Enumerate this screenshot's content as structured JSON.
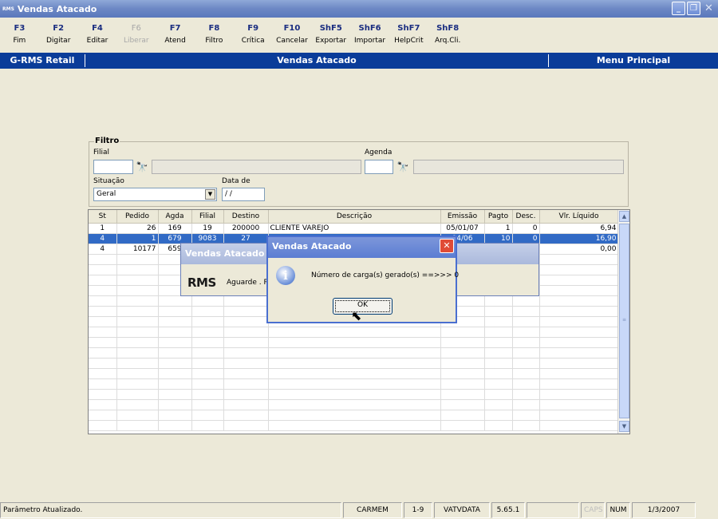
{
  "window": {
    "title": "Vendas Atacado",
    "app_icon_text": "RMS"
  },
  "toolbar": [
    {
      "key": "F3",
      "label": "Fim",
      "enabled": true
    },
    {
      "key": "F2",
      "label": "Digitar",
      "enabled": true
    },
    {
      "key": "F4",
      "label": "Editar",
      "enabled": true
    },
    {
      "key": "F6",
      "label": "Liberar",
      "enabled": false
    },
    {
      "key": "F7",
      "label": "Atend",
      "enabled": true
    },
    {
      "key": "F8",
      "label": "Filtro",
      "enabled": true
    },
    {
      "key": "F9",
      "label": "Crítica",
      "enabled": true
    },
    {
      "key": "F10",
      "label": "Cancelar",
      "enabled": true
    },
    {
      "key": "ShF5",
      "label": "Exportar",
      "enabled": true
    },
    {
      "key": "ShF6",
      "label": "Importar",
      "enabled": true
    },
    {
      "key": "ShF7",
      "label": "HelpCrit",
      "enabled": true
    },
    {
      "key": "ShF8",
      "label": "Arq.Cli.",
      "enabled": true
    }
  ],
  "header": {
    "left": "G-RMS Retail",
    "center": "Vendas Atacado",
    "right": "Menu Principal"
  },
  "filtro": {
    "legend": "Filtro",
    "filial_label": "Filial",
    "filial_value": "",
    "agenda_label": "Agenda",
    "agenda_value": "",
    "situacao_label": "Situação",
    "situacao_value": "Geral",
    "data_label": "Data de",
    "data_value": " / /"
  },
  "grid": {
    "columns": [
      "St",
      "Pedido",
      "Agda",
      "Filial",
      "Destino",
      "Descrição",
      "Emissão",
      "Pagto",
      "Desc.",
      "Vlr. Líquido"
    ],
    "rows": [
      [
        "1",
        "26",
        "169",
        "19",
        "200000",
        "CLIENTE VAREJO",
        "05/01/07",
        "1",
        "0",
        "6,94"
      ],
      [
        "4",
        "1",
        "679",
        "9083",
        "27",
        "",
        "04/06",
        "10",
        "0",
        "16,90"
      ],
      [
        "4",
        "10177",
        "659",
        "",
        "",
        "",
        "",
        "",
        "",
        "0,00"
      ]
    ],
    "selected_row": 1
  },
  "status": {
    "message": "Parâmetro Atualizado.",
    "user": "CARMEM",
    "range": "1-9",
    "db": "VATVDATA",
    "version": "5.65.1",
    "caps": "CAPS",
    "num": "NUM",
    "date": "1/3/2007"
  },
  "dialog_back": {
    "title": "Vendas Atacado",
    "logo": "RMS",
    "message": "Aguarde . R"
  },
  "dialog_front": {
    "title": "Vendas Atacado",
    "message": "Número de carga(s) gerado(s) ==>>> 0",
    "ok_label": "OK"
  },
  "colors": {
    "header_bg": "#0A3C99",
    "selected_row": "#316AC5",
    "title_bar": "#6C87C4"
  }
}
